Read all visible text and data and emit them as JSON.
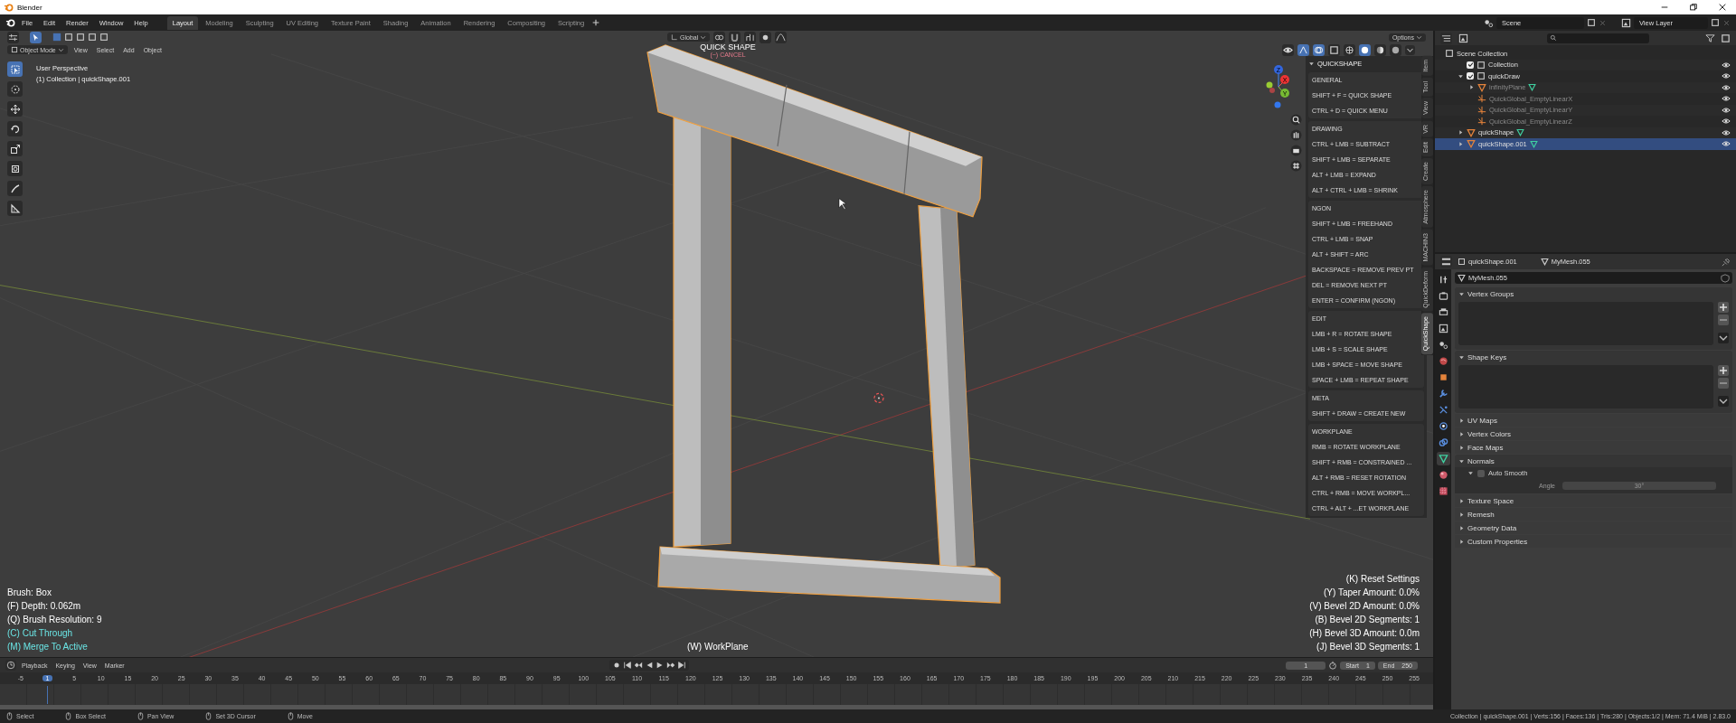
{
  "window": {
    "title": "Blender"
  },
  "menu": [
    "File",
    "Edit",
    "Render",
    "Window",
    "Help"
  ],
  "workspaces": [
    {
      "label": "Layout",
      "selected": true
    },
    {
      "label": "Modeling",
      "selected": false
    },
    {
      "label": "Sculpting",
      "selected": false
    },
    {
      "label": "UV Editing",
      "selected": false
    },
    {
      "label": "Texture Paint",
      "selected": false
    },
    {
      "label": "Shading",
      "selected": false
    },
    {
      "label": "Animation",
      "selected": false
    },
    {
      "label": "Rendering",
      "selected": false
    },
    {
      "label": "Compositing",
      "selected": false
    },
    {
      "label": "Scripting",
      "selected": false
    }
  ],
  "scene": {
    "scene": "Scene",
    "view_layer": "View Layer"
  },
  "viewport_header": {
    "orientation": "Global",
    "options": "Options",
    "mode": "Object Mode",
    "menus": [
      "View",
      "Select",
      "Add",
      "Object"
    ]
  },
  "tools": [
    {
      "kind": "select",
      "selected": true
    },
    {
      "kind": "cursor",
      "selected": false
    },
    {
      "kind": "move",
      "selected": false
    },
    {
      "kind": "rotate",
      "selected": false
    },
    {
      "kind": "scale",
      "selected": false
    },
    {
      "kind": "transform",
      "selected": false
    },
    {
      "kind": "annotate",
      "selected": false
    },
    {
      "kind": "measure",
      "selected": false
    }
  ],
  "viewport": {
    "view_name": "User Perspective",
    "context": "(1) Collection | quickShape.001",
    "tool_title": "QUICK SHAPE",
    "cancel_hint": "(~) CANCEL",
    "axes": [
      "X",
      "Y",
      "Z"
    ],
    "brush_settings": [
      {
        "text": "Brush: Box",
        "active": false
      },
      {
        "text": "(F) Depth: 0.062m",
        "active": false
      },
      {
        "text": "(Q) Brush Resolution: 9",
        "active": false
      },
      {
        "text": "(C) Cut Through",
        "active": true
      },
      {
        "text": "(M) Merge To Active",
        "active": true
      }
    ],
    "workplane": "(W) WorkPlane",
    "shape_settings": [
      "(K) Reset Settings",
      "(Y) Taper Amount: 0.0%",
      "(V) Bevel 2D Amount: 0.0%",
      "(B) Bevel 2D Segments: 1",
      "(H) Bevel 3D Amount: 0.0m",
      "(J) Bevel 3D Segments: 1"
    ]
  },
  "sidebar": {
    "title": "QUICKSHAPE",
    "sections": [
      {
        "heading": "GENERAL",
        "lines": [
          "SHIFT + F = QUICK SHAPE",
          "CTRL + D = QUICK MENU"
        ]
      },
      {
        "heading": "DRAWING",
        "lines": [
          "CTRL + LMB = SUBTRACT",
          "SHIFT + LMB = SEPARATE",
          "ALT + LMB = EXPAND",
          "ALT + CTRL + LMB = SHRINK"
        ]
      },
      {
        "heading": "NGON",
        "lines": [
          "SHIFT + LMB = FREEHAND",
          "CTRL + LMB = SNAP",
          "ALT + SHIFT = ARC",
          "BACKSPACE = REMOVE PREV PT",
          "DEL = REMOVE NEXT PT",
          "ENTER = CONFIRM (NGON)"
        ]
      },
      {
        "heading": "EDIT",
        "lines": [
          "LMB + R = ROTATE SHAPE",
          "LMB + S = SCALE SHAPE",
          "LMB + SPACE = MOVE SHAPE",
          "SPACE + LMB = REPEAT SHAPE"
        ]
      },
      {
        "heading": "META",
        "lines": [
          "SHIFT + DRAW = CREATE NEW"
        ]
      },
      {
        "heading": "WORKPLANE",
        "lines": [
          "RMB = ROTATE WORKPLANE",
          "SHIFT + RMB = CONSTRAINED ...",
          "ALT + RMB = RESET ROTATION",
          "CTRL + RMB = MOVE WORKPL...",
          "CTRL + ALT + ...ET WORKPLANE"
        ]
      }
    ]
  },
  "sidebar_tabs": [
    {
      "label": "Item",
      "selected": false
    },
    {
      "label": "Tool",
      "selected": false
    },
    {
      "label": "View",
      "selected": false
    },
    {
      "label": "VR",
      "selected": false
    },
    {
      "label": "Edit",
      "selected": false
    },
    {
      "label": "Create",
      "selected": false
    },
    {
      "label": "Atmosphere",
      "selected": false
    },
    {
      "label": "MACHIN3",
      "selected": false
    },
    {
      "label": "QuickDeform",
      "selected": false
    },
    {
      "label": "QuickShape",
      "selected": true
    }
  ],
  "timeline": {
    "menus": [
      "Playback",
      "Keying",
      "View",
      "Marker"
    ],
    "current_frame": "1",
    "start_label": "Start",
    "start": "1",
    "end_label": "End",
    "end": "250",
    "ruler": [
      {
        "label": "-5",
        "selected": false
      },
      {
        "label": "1",
        "selected": true
      },
      {
        "label": "5",
        "selected": false
      },
      {
        "label": "10",
        "selected": false
      },
      {
        "label": "15",
        "selected": false
      },
      {
        "label": "20",
        "selected": false
      },
      {
        "label": "25",
        "selected": false
      },
      {
        "label": "30",
        "selected": false
      },
      {
        "label": "35",
        "selected": false
      },
      {
        "label": "40",
        "selected": false
      },
      {
        "label": "45",
        "selected": false
      },
      {
        "label": "50",
        "selected": false
      },
      {
        "label": "55",
        "selected": false
      },
      {
        "label": "60",
        "selected": false
      },
      {
        "label": "65",
        "selected": false
      },
      {
        "label": "70",
        "selected": false
      },
      {
        "label": "75",
        "selected": false
      },
      {
        "label": "80",
        "selected": false
      },
      {
        "label": "85",
        "selected": false
      },
      {
        "label": "90",
        "selected": false
      },
      {
        "label": "95",
        "selected": false
      },
      {
        "label": "100",
        "selected": false
      },
      {
        "label": "105",
        "selected": false
      },
      {
        "label": "110",
        "selected": false
      },
      {
        "label": "115",
        "selected": false
      },
      {
        "label": "120",
        "selected": false
      },
      {
        "label": "125",
        "selected": false
      },
      {
        "label": "130",
        "selected": false
      },
      {
        "label": "135",
        "selected": false
      },
      {
        "label": "140",
        "selected": false
      },
      {
        "label": "145",
        "selected": false
      },
      {
        "label": "150",
        "selected": false
      },
      {
        "label": "155",
        "selected": false
      },
      {
        "label": "160",
        "selected": false
      },
      {
        "label": "165",
        "selected": false
      },
      {
        "label": "170",
        "selected": false
      },
      {
        "label": "175",
        "selected": false
      },
      {
        "label": "180",
        "selected": false
      },
      {
        "label": "185",
        "selected": false
      },
      {
        "label": "190",
        "selected": false
      },
      {
        "label": "195",
        "selected": false
      },
      {
        "label": "200",
        "selected": false
      },
      {
        "label": "205",
        "selected": false
      },
      {
        "label": "210",
        "selected": false
      },
      {
        "label": "215",
        "selected": false
      },
      {
        "label": "220",
        "selected": false
      },
      {
        "label": "225",
        "selected": false
      },
      {
        "label": "230",
        "selected": false
      },
      {
        "label": "235",
        "selected": false
      },
      {
        "label": "240",
        "selected": false
      },
      {
        "label": "245",
        "selected": false
      },
      {
        "label": "250",
        "selected": false
      },
      {
        "label": "255",
        "selected": false
      }
    ]
  },
  "outliner": {
    "root": "Scene Collection",
    "items": [
      {
        "name": "Collection",
        "kind": "collection",
        "checked": true,
        "selected": false,
        "dimmed": false
      },
      {
        "name": "quickDraw",
        "kind": "collection",
        "checked": true,
        "expanded": true,
        "selected": false,
        "dimmed": false,
        "children": [
          {
            "name": "infinityPlane",
            "kind": "mesh",
            "expanded": false,
            "selected": false,
            "dimmed": true
          },
          {
            "name": "QuickGlobal_EmptyLinearX",
            "kind": "empty",
            "selected": false,
            "dimmed": true
          },
          {
            "name": "QuickGlobal_EmptyLinearY",
            "kind": "empty",
            "selected": false,
            "dimmed": true
          },
          {
            "name": "QuickGlobal_EmptyLinearZ",
            "kind": "empty",
            "selected": false,
            "dimmed": true
          }
        ]
      },
      {
        "name": "quickShape",
        "kind": "mesh",
        "expanded": false,
        "selected": false,
        "dimmed": false
      },
      {
        "name": "quickShape.001",
        "kind": "mesh",
        "expanded": false,
        "selected": true,
        "dimmed": false
      }
    ]
  },
  "properties": {
    "object": "quickShape.001",
    "mesh": "MyMesh.055",
    "mesh_field": "MyMesh.055",
    "tabs": [
      {
        "kind": "tool",
        "selected": false
      },
      {
        "kind": "render",
        "selected": false
      },
      {
        "kind": "output",
        "selected": false
      },
      {
        "kind": "view_layer",
        "selected": false
      },
      {
        "kind": "scene",
        "selected": false
      },
      {
        "kind": "world",
        "selected": false
      },
      {
        "kind": "object",
        "selected": false
      },
      {
        "kind": "modifiers",
        "selected": false
      },
      {
        "kind": "particles",
        "selected": false
      },
      {
        "kind": "physics",
        "selected": false
      },
      {
        "kind": "constraints",
        "selected": false
      },
      {
        "kind": "data",
        "selected": true
      },
      {
        "kind": "material",
        "selected": false
      },
      {
        "kind": "texture",
        "selected": false
      }
    ],
    "panels": [
      {
        "title": "Vertex Groups",
        "kind": "list",
        "expanded": true
      },
      {
        "title": "Shape Keys",
        "kind": "list",
        "expanded": true
      },
      {
        "title": "UV Maps",
        "kind": "plain",
        "expanded": false
      },
      {
        "title": "Vertex Colors",
        "kind": "plain",
        "expanded": false
      },
      {
        "title": "Face Maps",
        "kind": "plain",
        "expanded": false
      },
      {
        "title": "Normals",
        "kind": "normals",
        "expanded": true,
        "option": {
          "label": "Auto Smooth",
          "checked": false,
          "expanded": true
        },
        "field_label": "Angle",
        "field_value": "30°"
      },
      {
        "title": "Texture Space",
        "kind": "plain",
        "expanded": false
      },
      {
        "title": "Remesh",
        "kind": "plain",
        "expanded": false
      },
      {
        "title": "Geometry Data",
        "kind": "plain",
        "expanded": false
      },
      {
        "title": "Custom Properties",
        "kind": "plain",
        "expanded": false
      }
    ]
  },
  "status_bar": {
    "actions": [
      "Select",
      "Box Select",
      "Pan View",
      "Set 3D Cursor",
      "Move"
    ],
    "stats": "Collection | quickShape.001 | Verts:156 | Faces:136 | Tris:280 | Objects:1/2 | Mem: 71.4 MiB | 2.83.0"
  }
}
